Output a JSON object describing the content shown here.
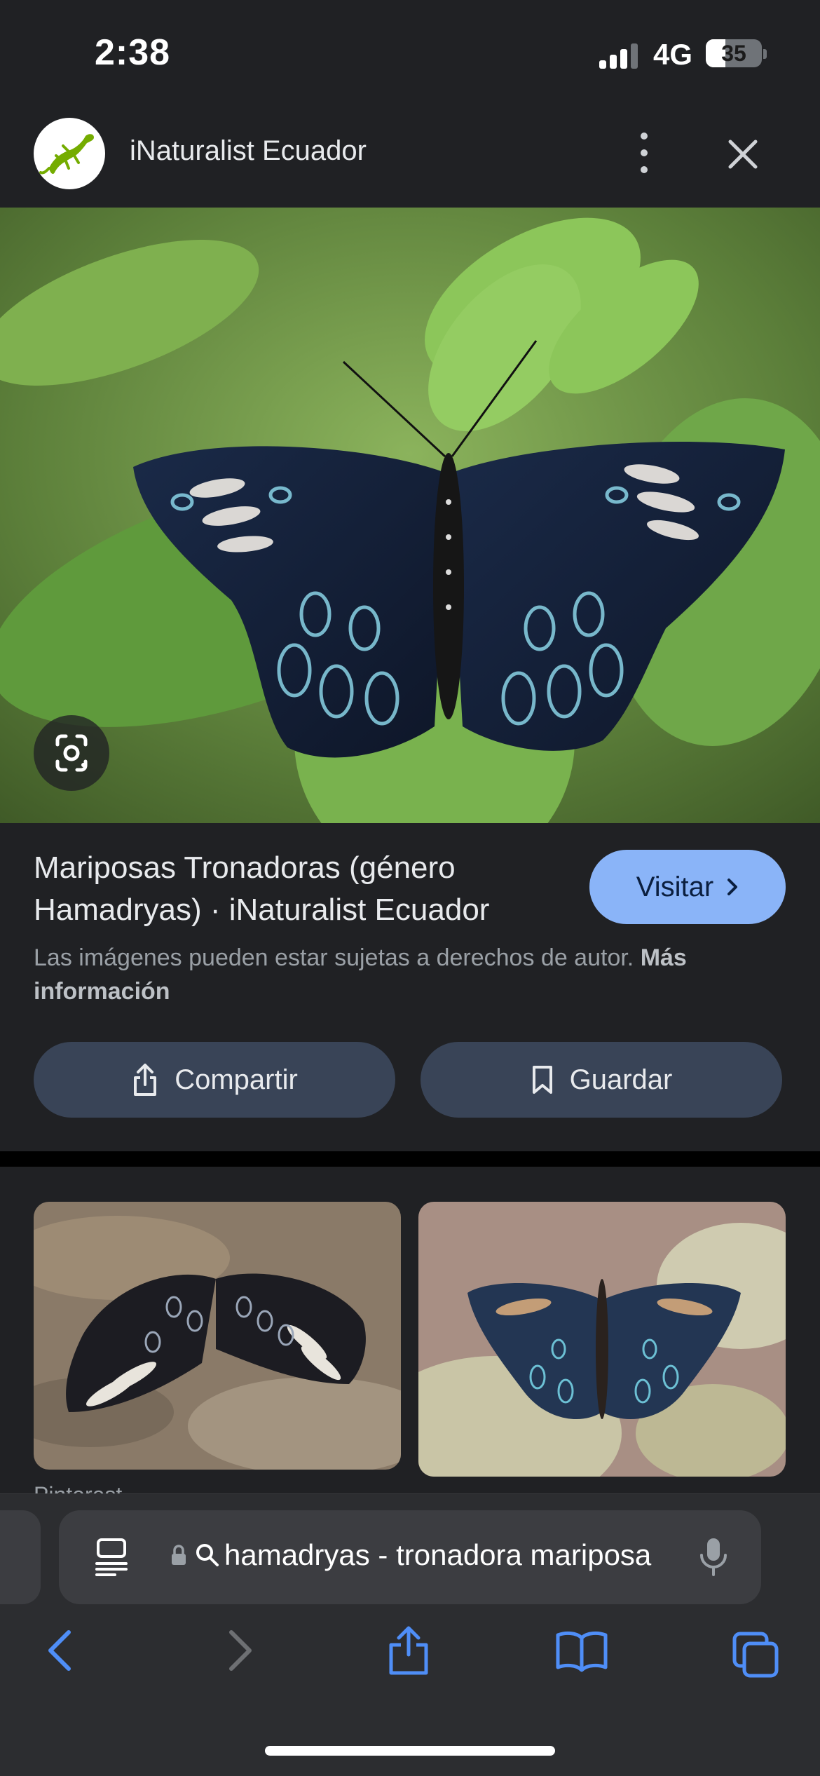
{
  "status_bar": {
    "time": "2:38",
    "network": "4G",
    "battery": "35",
    "battery_level": 0.35
  },
  "header": {
    "site_name": "iNaturalist Ecuador",
    "logo_icon": "lizard-icon",
    "more_icon": "more-vertical-icon",
    "close_icon": "close-icon"
  },
  "hero": {
    "image": "blue-butterfly-on-leaf",
    "lens_icon": "google-lens-icon"
  },
  "result": {
    "title": "Mariposas Tronadoras (género Hamadryas) · iNaturalist Ecuador",
    "visit_label": "Visitar",
    "copyright_text": "Las imágenes pueden estar sujetas a derechos de autor.",
    "more_info_label": "Más información"
  },
  "actions": {
    "share_label": "Compartir",
    "save_label": "Guardar"
  },
  "related": {
    "caption": "Pinterest"
  },
  "browser": {
    "address": "hamadryas - tronadora mariposa",
    "accent": "#4f8ef7",
    "disabled": "#6e7073"
  }
}
